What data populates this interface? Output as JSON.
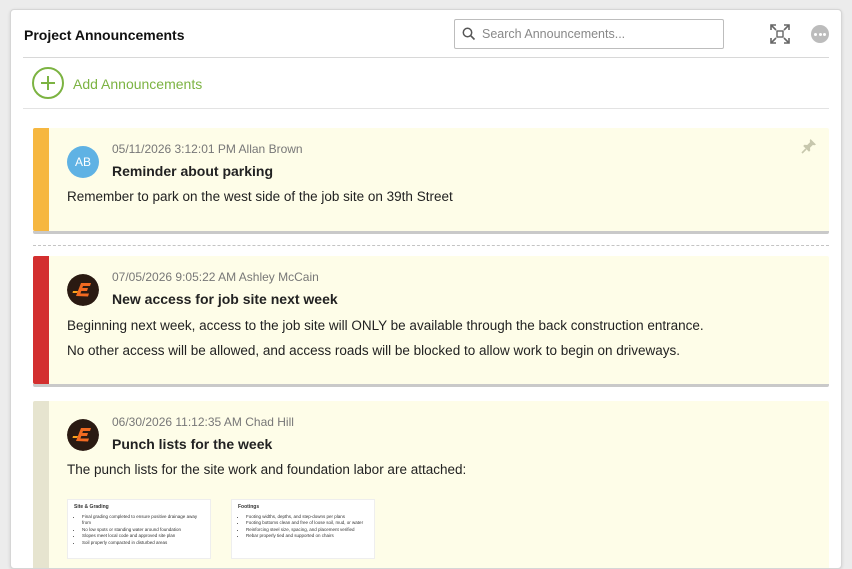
{
  "header": {
    "title": "Project Announcements",
    "search_placeholder": "Search Announcements...",
    "expand_icon": "expand-icon",
    "more_icon": "more-options-icon"
  },
  "add": {
    "label": "Add Announcements",
    "color": "#7cb342"
  },
  "announcements": [
    {
      "timestamp": "05/11/2026 3:12:01 PM",
      "author": "Allan Brown",
      "avatar_initials": "AB",
      "title": "Reminder about parking",
      "body": [
        "Remember to park on the west side of the job site on 39th Street"
      ],
      "accent": "#f6b740",
      "pinned": true
    },
    {
      "timestamp": "07/05/2026 9:05:22 AM",
      "author": "Ashley McCain",
      "avatar_icon": "company-logo-icon",
      "title": "New access for job site next week",
      "body": [
        "Beginning next week, access to the job site will ONLY be available through the back construction entrance.",
        "No other access will be allowed, and access roads will be blocked to allow work to begin on driveways."
      ],
      "accent": "#d32f2f"
    },
    {
      "timestamp": "06/30/2026 11:12:35 AM",
      "author": "Chad Hill",
      "avatar_icon": "company-logo-icon",
      "title": "Punch lists for the week",
      "body": [
        "The punch lists for the site work and foundation labor are attached:"
      ],
      "accent": "#e6e4cf",
      "attachments": [
        {
          "title": "Site & Grading",
          "items": [
            "Final grading completed to ensure positive drainage away from",
            "No low spots or standing water around foundation",
            "Slopes meet local code and approved site plan",
            "Soil properly compacted in disturbed areas"
          ]
        },
        {
          "title": "Footings",
          "items": [
            "Footing widths, depths, and step-downs per plans",
            "Footing bottoms clean and free of loose soil, mud, or water",
            "Reinforcing steel size, spacing, and placement verified",
            "Rebar properly tied and supported on chairs"
          ]
        }
      ]
    }
  ]
}
